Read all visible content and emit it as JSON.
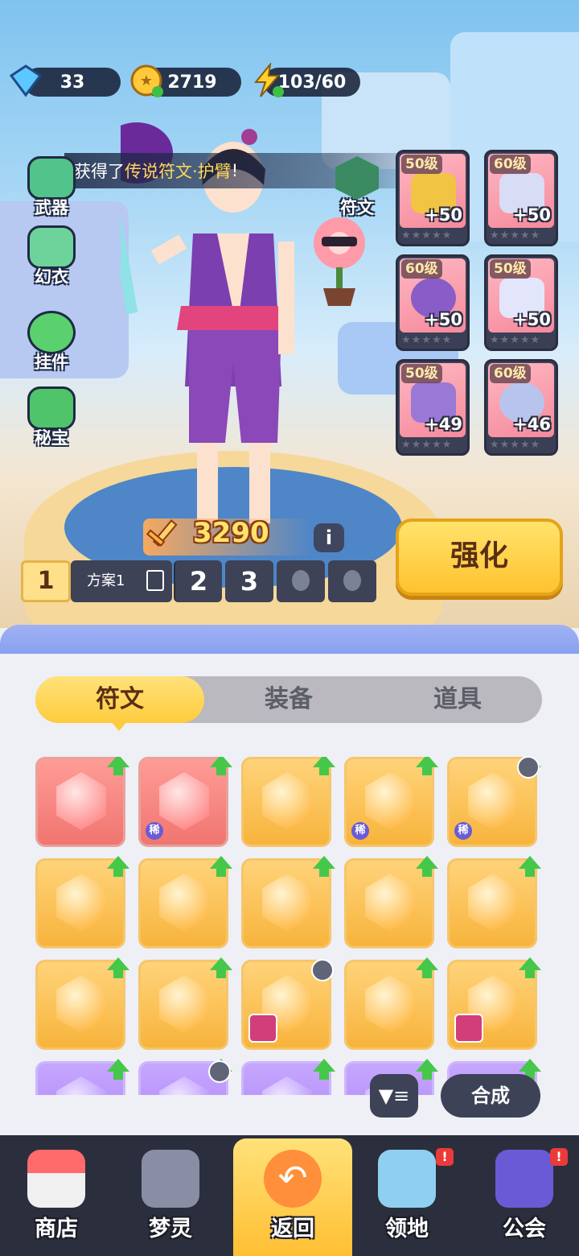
{
  "resources": {
    "diamonds": "33",
    "coins": "2719",
    "energy": "103/60"
  },
  "notification": {
    "prefix": "获得了",
    "highlight": "传说符文·护臂",
    "suffix": "!"
  },
  "side_menu": [
    {
      "label": "武器",
      "icon": "weapon-icon"
    },
    {
      "label": "幻衣",
      "icon": "costume-icon"
    },
    {
      "label": "挂件",
      "icon": "pendant-icon"
    },
    {
      "label": "秘宝",
      "icon": "treasure-icon"
    }
  ],
  "rune_label": "符文",
  "equipment_slots": [
    {
      "level": "50级",
      "bonus": "+50",
      "icon": "helmet-icon"
    },
    {
      "level": "60级",
      "bonus": "+50",
      "icon": "jacket-icon"
    },
    {
      "level": "60级",
      "bonus": "+50",
      "icon": "bracer-icon"
    },
    {
      "level": "50级",
      "bonus": "+50",
      "icon": "pants-icon"
    },
    {
      "level": "50级",
      "bonus": "+49",
      "icon": "shoes-icon"
    },
    {
      "level": "60级",
      "bonus": "+46",
      "icon": "eye-orb-icon"
    }
  ],
  "power": "3290",
  "strengthen_label": "强化",
  "presets": {
    "current": "1",
    "current_name": "方案1",
    "others": [
      "2",
      "3"
    ]
  },
  "tabs": [
    {
      "label": "符文",
      "active": true
    },
    {
      "label": "装备",
      "active": false
    },
    {
      "label": "道具",
      "active": false
    }
  ],
  "rune_grid": [
    {
      "color": "red",
      "rare": false,
      "up": true
    },
    {
      "color": "red",
      "rare": true,
      "up": true
    },
    {
      "color": "gold",
      "rare": false,
      "up": true
    },
    {
      "color": "gold",
      "rare": true,
      "up": true
    },
    {
      "color": "gold",
      "rare": true,
      "up": true,
      "locked": true
    },
    {
      "color": "gold",
      "up": true
    },
    {
      "color": "gold",
      "up": true
    },
    {
      "color": "gold",
      "up": true
    },
    {
      "color": "gold",
      "up": true
    },
    {
      "color": "gold",
      "up": true
    },
    {
      "color": "gold",
      "up": true
    },
    {
      "color": "gold",
      "up": true
    },
    {
      "color": "gold",
      "up": false,
      "locked": true,
      "pet": true
    },
    {
      "color": "gold",
      "up": true
    },
    {
      "color": "gold",
      "up": true,
      "pet": true
    },
    {
      "color": "purple",
      "up": true
    },
    {
      "color": "purple",
      "up": true,
      "locked": true
    },
    {
      "color": "purple",
      "up": true
    },
    {
      "color": "purple",
      "up": true
    },
    {
      "color": "purple",
      "up": true
    }
  ],
  "rare_tag": "稀",
  "merge_label": "合成",
  "bottom_nav": [
    {
      "label": "商店",
      "icon": "shop-icon",
      "badge": false
    },
    {
      "label": "梦灵",
      "icon": "spirit-icon",
      "badge": false
    },
    {
      "label": "返回",
      "icon": "return-icon",
      "badge": false
    },
    {
      "label": "领地",
      "icon": "territory-icon",
      "badge": true
    },
    {
      "label": "公会",
      "icon": "guild-icon",
      "badge": true
    }
  ],
  "badge_text": "!",
  "colors": {
    "accent_yellow": "#ffcb3d",
    "panel_blue": "#8aa0ee",
    "nav_dark": "#2b2f3d"
  }
}
